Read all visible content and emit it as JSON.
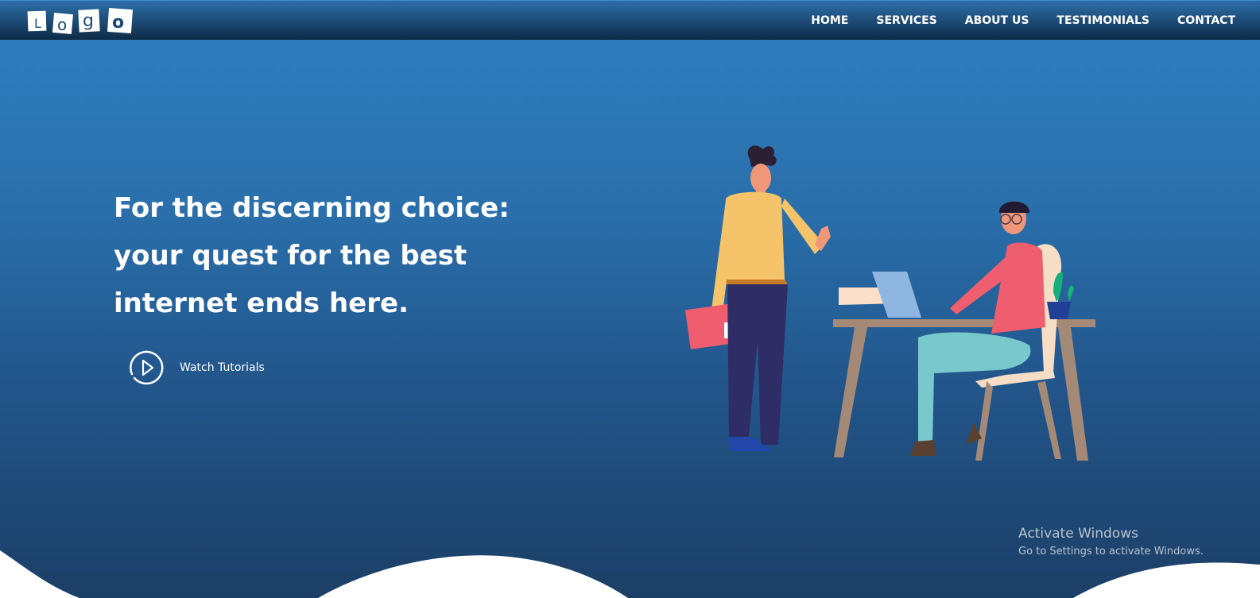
{
  "logo": {
    "letters": [
      "L",
      "o",
      "g",
      "o"
    ]
  },
  "nav": {
    "items": [
      {
        "label": "HOME"
      },
      {
        "label": "SERVICES"
      },
      {
        "label": "ABOUT US"
      },
      {
        "label": "TESTIMONIALS"
      },
      {
        "label": "CONTACT"
      }
    ]
  },
  "hero": {
    "title_lines": [
      "For the discerning choice:",
      "your quest for the best",
      "internet ends here."
    ],
    "watch_label": "Watch Tutorials",
    "watch_icon": "play-circle-icon"
  },
  "os_overlay": {
    "title": "Activate Windows",
    "subtitle": "Go to Settings to activate Windows."
  },
  "colors": {
    "hero_top": "#2f80c2",
    "hero_bottom": "#1c3f66",
    "nav_dark": "#0f2c47",
    "wave": "#ffffff"
  }
}
